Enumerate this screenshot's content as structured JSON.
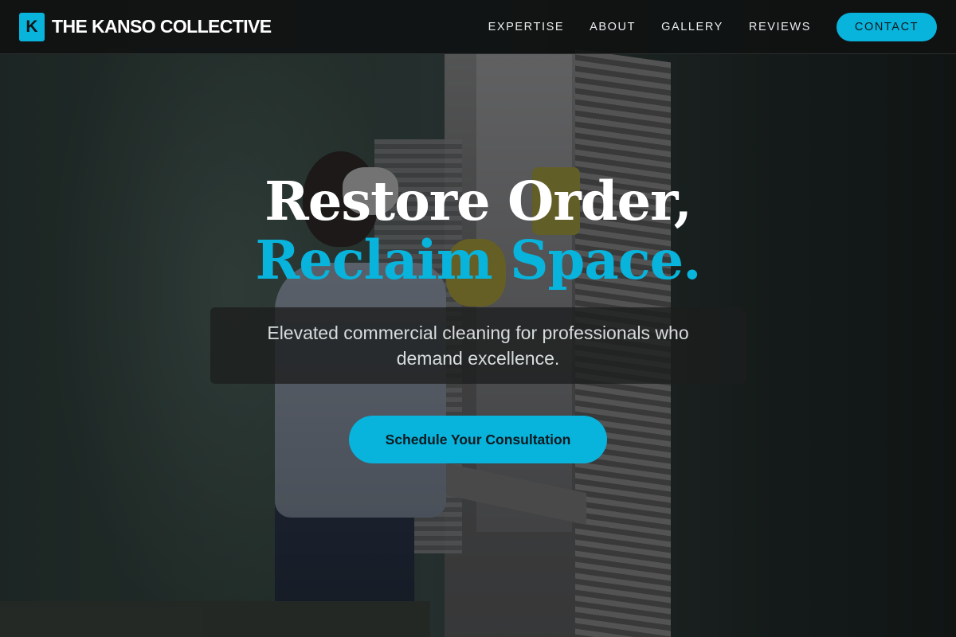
{
  "brand": {
    "logo_letter": "K",
    "name": "THE KANSO COLLECTIVE",
    "accent_color": "#08b3dc"
  },
  "nav": {
    "links": [
      {
        "label": "EXPERTISE"
      },
      {
        "label": "ABOUT"
      },
      {
        "label": "GALLERY"
      },
      {
        "label": "REVIEWS"
      }
    ],
    "contact_label": "CONTACT"
  },
  "hero": {
    "headline_line1": "Restore Order,",
    "headline_line2": "Reclaim Space.",
    "subtitle": "Elevated commercial cleaning for professionals who demand excellence.",
    "cta_label": "Schedule Your Consultation",
    "background_image": "cleaner-wiping-window-photo"
  }
}
